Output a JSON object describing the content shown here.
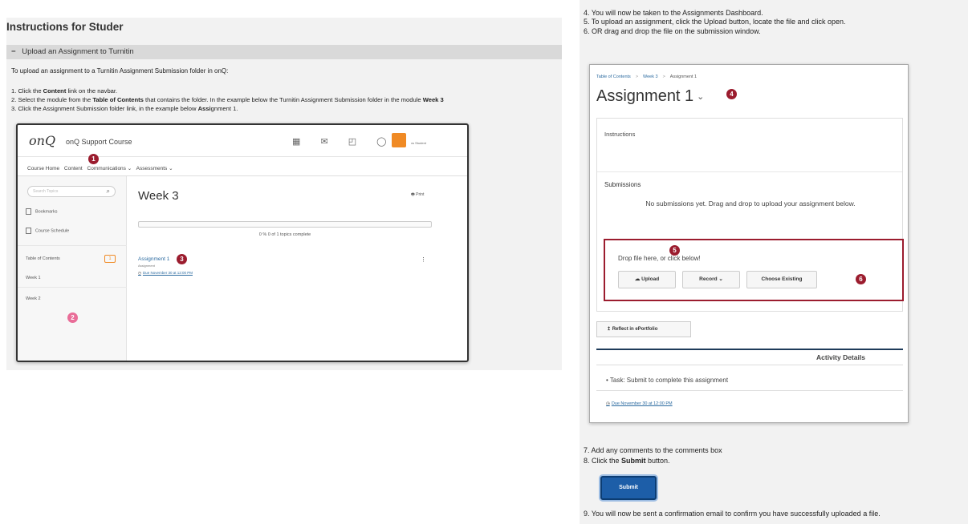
{
  "left": {
    "title": "Instructions for Studer",
    "collapse_label": "Upload an Assignment to Turnitin",
    "intro": "To upload an assignment to a Turnitin Assignment Submission folder in onQ:",
    "step1": {
      "pre": "1. Click the ",
      "bold": "Content",
      "post": " link on the navbar."
    },
    "step2": {
      "pre": "2. Select the module from the ",
      "bold": "Table of Contents",
      "post": " that contains the folder.  In the example below the Turnitin Assignment Submission folder in the module ",
      "bold2": "Week 3"
    },
    "step3": {
      "pre": "3. Click the Assignment Submission folder link, in the example below ",
      "bold": "Assi",
      "post": "gnment 1."
    }
  },
  "shot1": {
    "logo": "onQ",
    "course": "onQ Support Course",
    "head_icons": "▦ ✉ ◰ ◯",
    "user_text": "xs Student",
    "nav": [
      "Course Home",
      "Content",
      "Communications ⌄",
      "Assessments ⌄"
    ],
    "search_placeholder": "Search Topics",
    "sidebar": {
      "bookmarks": "Bookmarks",
      "schedule": "Course Schedule",
      "toc": "Table of Contents",
      "toc_count": "1",
      "week1": "Week 1",
      "week2": "Week 2"
    },
    "week_title": "Week 3",
    "print": "🖶 Print",
    "progress_fraction": 0.0,
    "progress_text": "0 %  0 of 1 topics complete",
    "assignment_link": "Assignment 1",
    "assignment_sub": "Assignment",
    "due": "Due November 30 at 12:00 PM",
    "kebab": "⋮",
    "markers": {
      "m1": "1",
      "m2": "2",
      "m3": "3"
    }
  },
  "right": {
    "step4": "4. You will now be taken to the Assignments Dashboard.",
    "step5": "5. To upload an assignment, click the Upload button, locate the file and click open.",
    "step6": "6. OR drag and drop the file on the submission window."
  },
  "shot2": {
    "crumbs": [
      "Table of Contents",
      "Week 3",
      "Assignment 1"
    ],
    "crumb_sep": ">",
    "title": "Assignment 1",
    "chevron": "⌄",
    "instructions": "Instructions",
    "submissions": "Submissions",
    "no_sub": "No submissions yet. Drag and drop to upload your assignment below.",
    "drop_text": "Drop file here, or click below!",
    "upload": "☁ Upload",
    "record": "Record  ⌄",
    "choose": "Choose Existing",
    "reflect": "↥ Reflect in ePortfolio",
    "activity": "Activity Details",
    "task": "•   Task: Submit to complete this assignment",
    "due": "Due November 30 at 12:00 PM",
    "markers": {
      "m4": "4",
      "m5": "5",
      "m6": "6"
    }
  },
  "bottom": {
    "step7": "7. Add any comments to the comments box",
    "step8": {
      "pre": "8. Click the ",
      "bold": "Submit",
      "post": " button."
    },
    "submit": "Submit",
    "step9": "9. You will now be sent a confirmation email to confirm you have successfully uploaded a file."
  }
}
